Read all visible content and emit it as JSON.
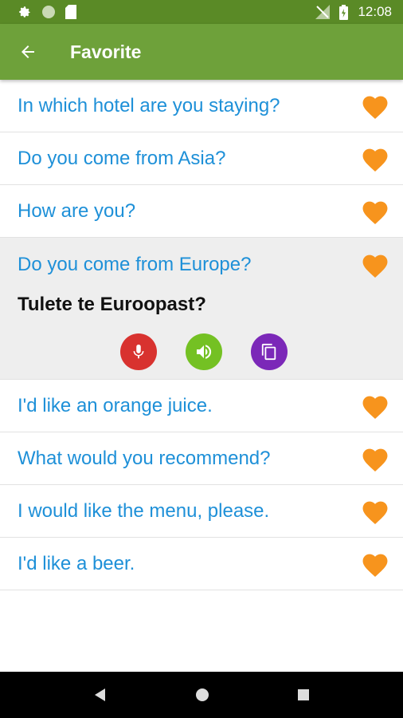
{
  "status_bar": {
    "time": "12:08",
    "left_icons": [
      "gear-icon",
      "circle-icon",
      "sd-card-icon"
    ],
    "right_icons": [
      "no-signal-icon",
      "battery-icon"
    ]
  },
  "app_bar": {
    "title": "Favorite",
    "back_icon": "arrow-left-icon",
    "background": "#6ea13a"
  },
  "colors": {
    "phrase_text": "#1e90d8",
    "heart": "#f7941d",
    "mic": "#d8322f",
    "speaker": "#74c123",
    "copy": "#7b28b8"
  },
  "phrases": [
    {
      "text": "In which hotel are you staying?"
    },
    {
      "text": "Do you come from Asia?"
    },
    {
      "text": "How are you?"
    },
    {
      "text": "Do you come from Europe?",
      "translation": "Tulete te Euroopast?",
      "expanded": true
    },
    {
      "text": "I'd like an orange juice."
    },
    {
      "text": "What would you recommend?"
    },
    {
      "text": "I would like the menu, please."
    },
    {
      "text": "I'd like a beer."
    }
  ],
  "nav_bar": {
    "icons": [
      "back-triangle-icon",
      "home-circle-icon",
      "recents-square-icon"
    ]
  }
}
